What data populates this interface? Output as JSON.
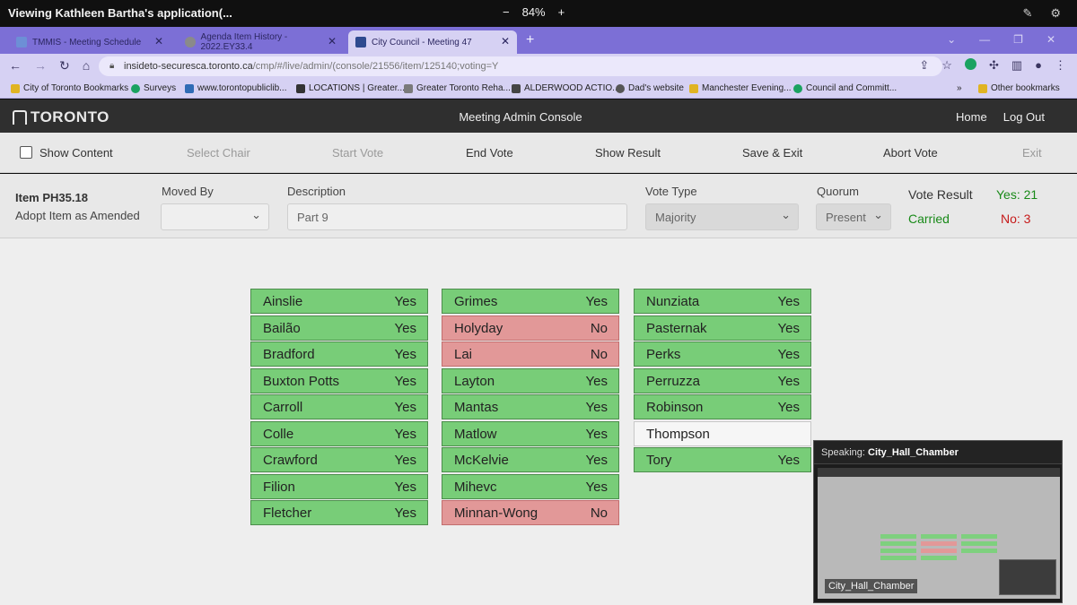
{
  "viewer": {
    "title": "Viewing Kathleen Bartha's application(...",
    "zoom_minus": "−",
    "zoom": "84%",
    "zoom_plus": "+"
  },
  "browser": {
    "tabs": [
      {
        "label": "TMMIS - Meeting Schedule",
        "color": "#6d8fd6"
      },
      {
        "label": "Agenda Item History - 2022.EY33.4",
        "color": "#8a8a8a"
      },
      {
        "label": "City Council - Meeting 47",
        "color": "#2e4a8f"
      }
    ],
    "new_tab": "+",
    "url_host": "insideto-securesca.toronto.ca",
    "url_path": "/cmp/#/live/admin/(console/21556/item/125140;voting=Y",
    "bookmarks": [
      {
        "label": "City of Toronto Bookmarks",
        "color": "#e0b422"
      },
      {
        "label": "Surveys",
        "color": "#1aa260"
      },
      {
        "label": "www.torontopubliclib...",
        "color": "#2f6bb5"
      },
      {
        "label": "LOCATIONS | Greater...",
        "color": "#333333"
      },
      {
        "label": "Greater Toronto Reha...",
        "color": "#7a7a7a"
      },
      {
        "label": "ALDERWOOD ACTIO...",
        "color": "#444444"
      },
      {
        "label": "Dad's website",
        "color": "#555555"
      },
      {
        "label": "Manchester Evening...",
        "color": "#e0b422"
      },
      {
        "label": "Council and Committ...",
        "color": "#1aa260"
      }
    ],
    "bookmarks_overflow": "»",
    "other_bookmarks": "Other bookmarks"
  },
  "app": {
    "logo": "TORONTO",
    "title": "Meeting Admin Console",
    "home": "Home",
    "logout": "Log Out"
  },
  "toolbar": {
    "show_content": "Show Content",
    "select_chair": "Select Chair",
    "start_vote": "Start Vote",
    "end_vote": "End Vote",
    "show_result": "Show Result",
    "save_exit": "Save & Exit",
    "abort_vote": "Abort Vote",
    "exit": "Exit"
  },
  "item": {
    "number": "Item PH35.18",
    "action": "Adopt Item as Amended",
    "moved_by_label": "Moved By",
    "moved_by_value": "",
    "description_label": "Description",
    "description_value": "Part 9",
    "vote_type_label": "Vote Type",
    "vote_type_value": "Majority",
    "quorum_label": "Quorum",
    "quorum_value": "Present"
  },
  "result": {
    "label": "Vote Result",
    "outcome": "Carried",
    "yes": "Yes: 21",
    "no": "No: 3"
  },
  "votes": [
    [
      {
        "name": "Ainslie",
        "vote": "Yes"
      },
      {
        "name": "Bailão",
        "vote": "Yes"
      },
      {
        "name": "Bradford",
        "vote": "Yes"
      },
      {
        "name": "Buxton Potts",
        "vote": "Yes"
      },
      {
        "name": "Carroll",
        "vote": "Yes"
      },
      {
        "name": "Colle",
        "vote": "Yes"
      },
      {
        "name": "Crawford",
        "vote": "Yes"
      },
      {
        "name": "Filion",
        "vote": "Yes"
      },
      {
        "name": "Fletcher",
        "vote": "Yes"
      }
    ],
    [
      {
        "name": "Grimes",
        "vote": "Yes"
      },
      {
        "name": "Holyday",
        "vote": "No"
      },
      {
        "name": "Lai",
        "vote": "No"
      },
      {
        "name": "Layton",
        "vote": "Yes"
      },
      {
        "name": "Mantas",
        "vote": "Yes"
      },
      {
        "name": "Matlow",
        "vote": "Yes"
      },
      {
        "name": "McKelvie",
        "vote": "Yes"
      },
      {
        "name": "Mihevc",
        "vote": "Yes"
      },
      {
        "name": "Minnan-Wong",
        "vote": "No"
      }
    ],
    [
      {
        "name": "Nunziata",
        "vote": "Yes"
      },
      {
        "name": "Pasternak",
        "vote": "Yes"
      },
      {
        "name": "Perks",
        "vote": "Yes"
      },
      {
        "name": "Perruzza",
        "vote": "Yes"
      },
      {
        "name": "Robinson",
        "vote": "Yes"
      },
      {
        "name": "Thompson",
        "vote": ""
      },
      {
        "name": "Tory",
        "vote": "Yes"
      }
    ]
  ],
  "speaker": {
    "prefix": "Speaking:",
    "name": "City_Hall_Chamber",
    "caption": "City_Hall_Chamber"
  }
}
